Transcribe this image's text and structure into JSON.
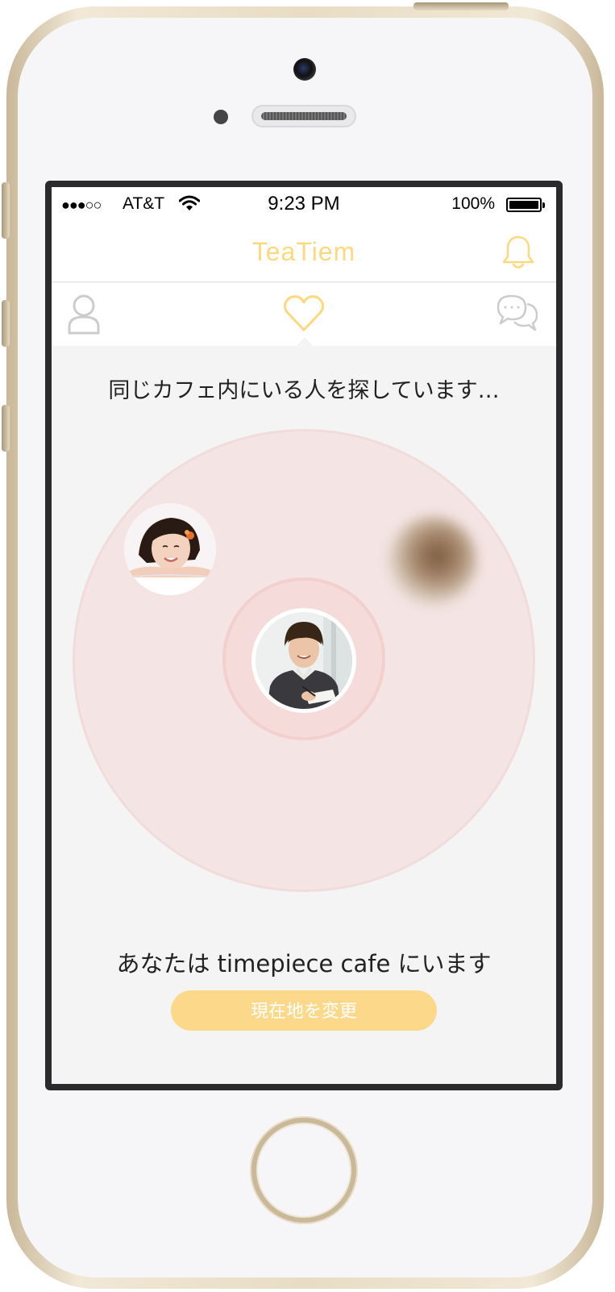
{
  "status_bar": {
    "signal": "●●●○○",
    "carrier": "AT&T",
    "time": "9:23 PM",
    "battery_percent": "100%"
  },
  "header": {
    "app_title": "TeaTiem",
    "icons": {
      "notifications": "bell-icon"
    }
  },
  "tabs": [
    {
      "id": "profile",
      "icon": "person-icon",
      "active": false
    },
    {
      "id": "match",
      "icon": "heart-icon",
      "active": true
    },
    {
      "id": "chat",
      "icon": "chat-bubbles-icon",
      "active": false
    }
  ],
  "main": {
    "searching_text": "同じカフェ内にいる人を探しています…",
    "location_text": "あなたは timepiece cafe にいます",
    "change_location_label": "現在地を変更"
  },
  "colors": {
    "accent": "#fcd87e",
    "button": "#fcd98a",
    "radar_outer": "#f4e4e3",
    "radar_inner": "#f5dcdb",
    "inactive_icon": "#cccccc"
  }
}
